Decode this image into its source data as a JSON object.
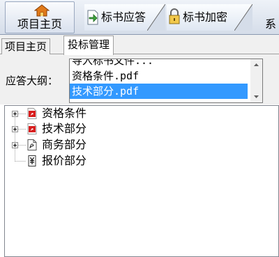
{
  "ribbon": {
    "home_label": "项目主页",
    "home_icon": "house-icon",
    "tabs": [
      {
        "label": "标书应答",
        "icon": "arrow-doc-icon"
      },
      {
        "label": "标书加密",
        "icon": "lock-icon"
      },
      {
        "label": "系"
      }
    ]
  },
  "subtabs": [
    {
      "label": "项目主页",
      "active": false
    },
    {
      "label": "投标管理",
      "active": true
    }
  ],
  "outline": {
    "label": "应答大纲：",
    "options": [
      "导入标书文件...",
      "资格条件.pdf",
      "技术部分.pdf"
    ],
    "selected": "技术部分.pdf"
  },
  "tree": {
    "nodes": [
      {
        "label": "资格条件",
        "icon": "pdf-icon",
        "expandable": true
      },
      {
        "label": "技术部分",
        "icon": "pdf-icon",
        "expandable": true
      },
      {
        "label": "商务部分",
        "icon": "pdf-outline-icon",
        "expandable": true
      },
      {
        "label": "报价部分",
        "icon": "price-doc-icon",
        "expandable": false
      }
    ]
  },
  "colors": {
    "selection": "#3399ff",
    "pdf_red": "#d81e1e"
  }
}
